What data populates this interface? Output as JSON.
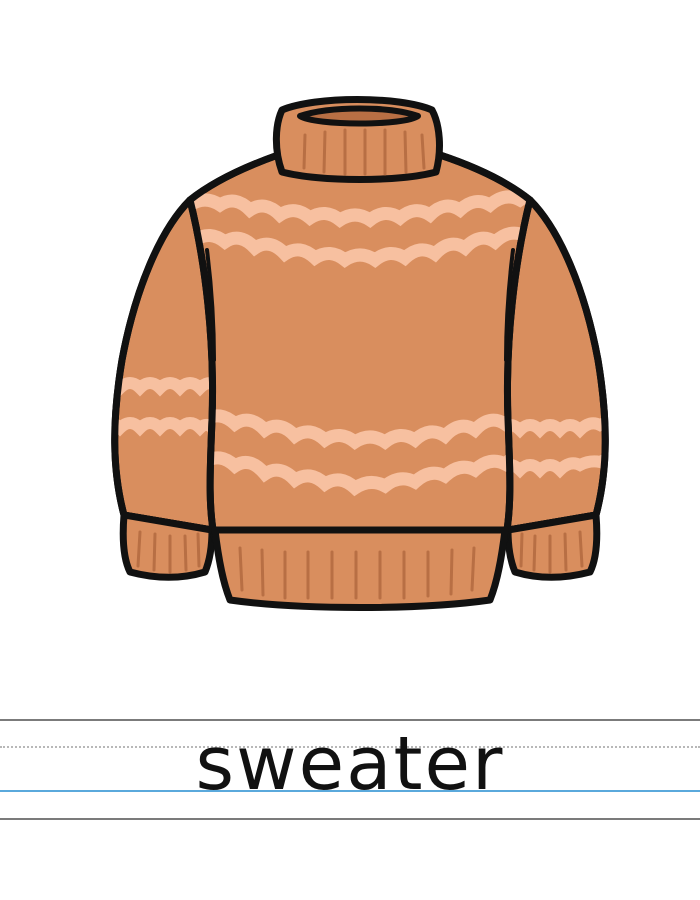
{
  "word": "sweater",
  "illustration": {
    "subject": "sweater-icon",
    "body_color": "#D98E5E",
    "stripe_color": "#F7C0A0",
    "outline_color": "#111111",
    "rib_line_color": "#B86F44"
  },
  "ruled_lines": {
    "top_color": "#7B7B7B",
    "midline_color": "#B8B8B8",
    "baseline_color": "#5AA9DC",
    "bottom_color": "#7B7B7B"
  }
}
